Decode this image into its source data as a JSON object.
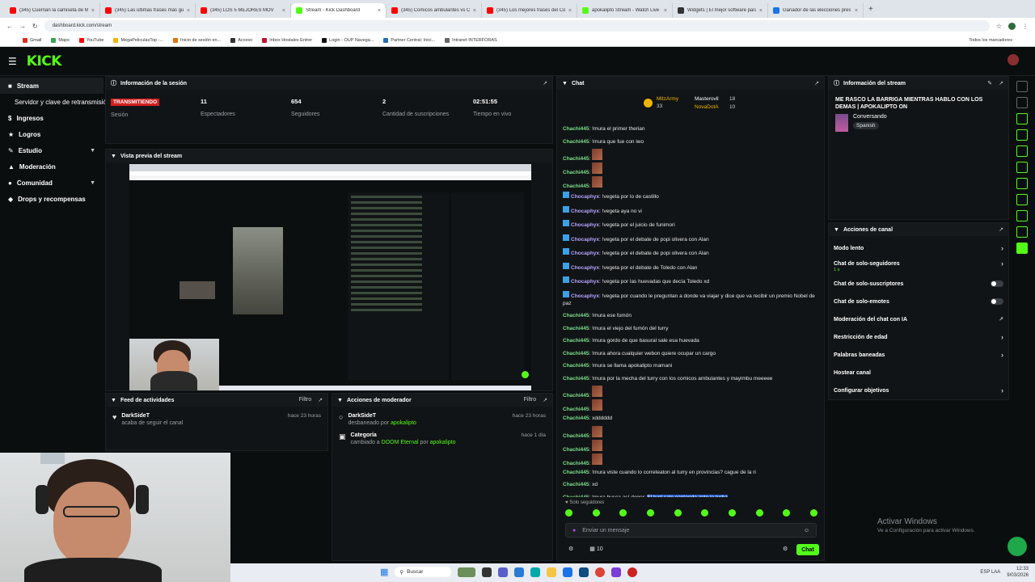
{
  "browser": {
    "tabs": [
      {
        "label": "(345) Cuernan la camiseta de M",
        "color": "#ff0000"
      },
      {
        "label": "(345) Las últimas frases más gu",
        "color": "#ff0000"
      },
      {
        "label": "(345) LOS 5 MEJORES MOV",
        "color": "#ff0000"
      },
      {
        "label": "Stream - Kick Dashboard",
        "color": "#53fc18",
        "active": true
      },
      {
        "label": "(345) Comicos ambulantes vs C",
        "color": "#ff0000"
      },
      {
        "label": "(345) Los mejores frases del Co",
        "color": "#ff0000"
      },
      {
        "label": "apokalipto Stream - Watch Live",
        "color": "#53fc18"
      },
      {
        "label": "Widgets | El mejor software para",
        "color": "#333333"
      },
      {
        "label": "Ganador de las elecciones pres",
        "color": "#1a73e8"
      }
    ],
    "url": "dashboard.kick.com/stream",
    "bookmarks": [
      "Gmail",
      "Maps",
      "YouTube",
      "MegaPeliculasTop -...",
      "Inicio de sesión en...",
      "Acceso",
      "Inbox Hostales Entrer",
      "Login - OUP Navega...",
      "Partner Central: Inici...",
      "Intranet INTERFORAS"
    ],
    "other_bookmarks": "Todos los marcadores"
  },
  "kick": {
    "logo": "KICK"
  },
  "sidebar": {
    "items": [
      {
        "label": "Stream",
        "icon": "video-icon",
        "active": true
      },
      {
        "label": "Servidor y clave de retransmisión"
      },
      {
        "label": "Ingresos",
        "icon": "dollar-icon"
      },
      {
        "label": "Logros",
        "icon": "trophy-icon"
      },
      {
        "label": "Estudio",
        "icon": "brush-icon",
        "chevron": true
      },
      {
        "label": "Moderación",
        "icon": "shield-icon"
      },
      {
        "label": "Comunidad",
        "icon": "people-icon",
        "chevron": true
      },
      {
        "label": "Drops y recompensas",
        "icon": "gift-icon"
      }
    ]
  },
  "session": {
    "title": "Información de la sesión",
    "live": "TRANSMITIENDO",
    "session_label": "Sesión",
    "stats": [
      {
        "value": "11",
        "label": "Espectadores"
      },
      {
        "value": "654",
        "label": "Seguidores"
      },
      {
        "value": "2",
        "label": "Cantidad de suscripciones"
      },
      {
        "value": "02:51:55",
        "label": "Tiempo en vivo"
      }
    ]
  },
  "preview": {
    "title": "Vista previa del stream"
  },
  "feed": {
    "title": "Feed de actividades",
    "filter": "Filtro",
    "items": [
      {
        "name": "DarkSideT",
        "sub": "acaba de seguir el canal",
        "time": "hace 23 horas"
      }
    ]
  },
  "modactions": {
    "title": "Acciones de moderador",
    "filter": "Filtro",
    "items": [
      {
        "name": "DarkSideT",
        "pre": "desbaneado por",
        "who": "apokalipto",
        "time": "hace 23 horas"
      },
      {
        "name": "Categoría",
        "pre": "cambiado a",
        "game": "DOOM Eternal",
        "por": "por",
        "who": "apokalipto",
        "time": "hace 1 día"
      }
    ]
  },
  "chat": {
    "title": "Chat",
    "top_gifters": [
      {
        "name": "MitzArmy",
        "count": "33"
      },
      {
        "name": "Masterovil",
        "count": "18"
      },
      {
        "name": "NovaDotA",
        "count": "10"
      }
    ],
    "messages": [
      {
        "user": "Chachi445",
        "text": "!mura el primer therian"
      },
      {
        "user": "Chachi445",
        "text": "!mura que fue con iwo"
      },
      {
        "user": "Chachi445",
        "text": "",
        "emote": true
      },
      {
        "user": "Chachi445",
        "text": "",
        "emote": true
      },
      {
        "user": "Chachi445",
        "text": "",
        "emote": true
      },
      {
        "user": "Chocaphyx",
        "text": "!vegeta por lo de castillo",
        "mod": true
      },
      {
        "user": "Chocaphyx",
        "text": "!vegeta aya no vi",
        "mod": true
      },
      {
        "user": "Chocaphyx",
        "text": "!vegeta por el juicio de funimori",
        "mod": true
      },
      {
        "user": "Chocaphyx",
        "text": "!vegeta por el debate de popi olivera con Alan",
        "mod": true
      },
      {
        "user": "Chocaphyx",
        "text": "!vegeta por el debate de popi olivera con Alan",
        "mod": true
      },
      {
        "user": "Chocaphyx",
        "text": "!vegeta por el debate de Toledo con Alan",
        "mod": true
      },
      {
        "user": "Chocaphyx",
        "text": "!vegeta por las huevadas que decía Toledo xd",
        "mod": true
      },
      {
        "user": "Chocaphyx",
        "text": "!vegeta por cuando le preguntan a donde va viajar y dice que va recibir un premio Nobel de paz",
        "mod": true
      },
      {
        "user": "Chachi445",
        "text": "!mura ese fumón"
      },
      {
        "user": "Chachi445",
        "text": "!mura el viejo del fumón del turry"
      },
      {
        "user": "Chachi445",
        "text": "!mura gordo de que basural sale esa huevada"
      },
      {
        "user": "Chachi445",
        "text": "!mura ahora cualquier webon quiere ocupar un cargo"
      },
      {
        "user": "Chachi445",
        "text": "!mura se llama apokalipto mamani"
      },
      {
        "user": "Chachi445",
        "text": "!mura por la mecha del turry con los comicos ambulantes y mayimbu meeeee"
      },
      {
        "user": "Chachi445",
        "text": "",
        "emote": true
      },
      {
        "user": "Chachi445",
        "text": "",
        "emote": true
      },
      {
        "user": "Chachi445",
        "text": "xdddddd"
      },
      {
        "user": "Chachi445",
        "text": "",
        "emote": true
      },
      {
        "user": "Chachi445",
        "text": "",
        "emote": true
      },
      {
        "user": "Chachi445",
        "text": "",
        "emote": true
      },
      {
        "user": "Chachi445",
        "text": "!mura viste cuando lo correteaton al turry en provincias? cague de la ri"
      },
      {
        "user": "Chachi445",
        "text": "xd"
      },
      {
        "user": "Chachi445",
        "text": "!mura busca así dogor: ",
        "highlight": "El turri sale corriendo ante la turba"
      },
      {
        "user": "Chachi445",
        "text": "",
        "emote": true
      }
    ],
    "mode": "Solo seguidores",
    "input_placeholder": "Enviar un mensaje",
    "viewers": "10",
    "send": "Chat"
  },
  "stream_info": {
    "title": "Información del stream",
    "stream_title": "ME RASCO LA BARRIGA MIENTRAS HABLO CON LOS DEMAS | APOKALIPTO ON",
    "category": "Conversando",
    "language": "Spanish"
  },
  "channel_actions": {
    "title": "Acciones de canal",
    "items": [
      {
        "label": "Modo lento",
        "control": "chevron"
      },
      {
        "label": "Chat de solo-seguidores",
        "sub": "1 s",
        "control": "chevron"
      },
      {
        "label": "Chat de solo-suscriptores",
        "control": "toggle"
      },
      {
        "label": "Chat de solo-emotes",
        "control": "toggle"
      },
      {
        "label": "Moderación del chat con IA",
        "control": "external"
      },
      {
        "label": "Restricción de edad",
        "control": "chevron"
      },
      {
        "label": "Palabras baneadas",
        "control": "chevron"
      },
      {
        "label": "Hostear canal",
        "control": "none"
      },
      {
        "label": "Configurar objetivos",
        "control": "chevron"
      }
    ]
  },
  "windows": {
    "activate_title": "Activar Windows",
    "activate_sub": "Ve a Configuración para activar Windows.",
    "search": "Buscar",
    "lang": "ESP LAA",
    "time": "12:33",
    "date": "9/03/2026"
  },
  "colors": {
    "accent": "#53fc18",
    "live": "#d32020",
    "bg": "#0b0e0f"
  }
}
